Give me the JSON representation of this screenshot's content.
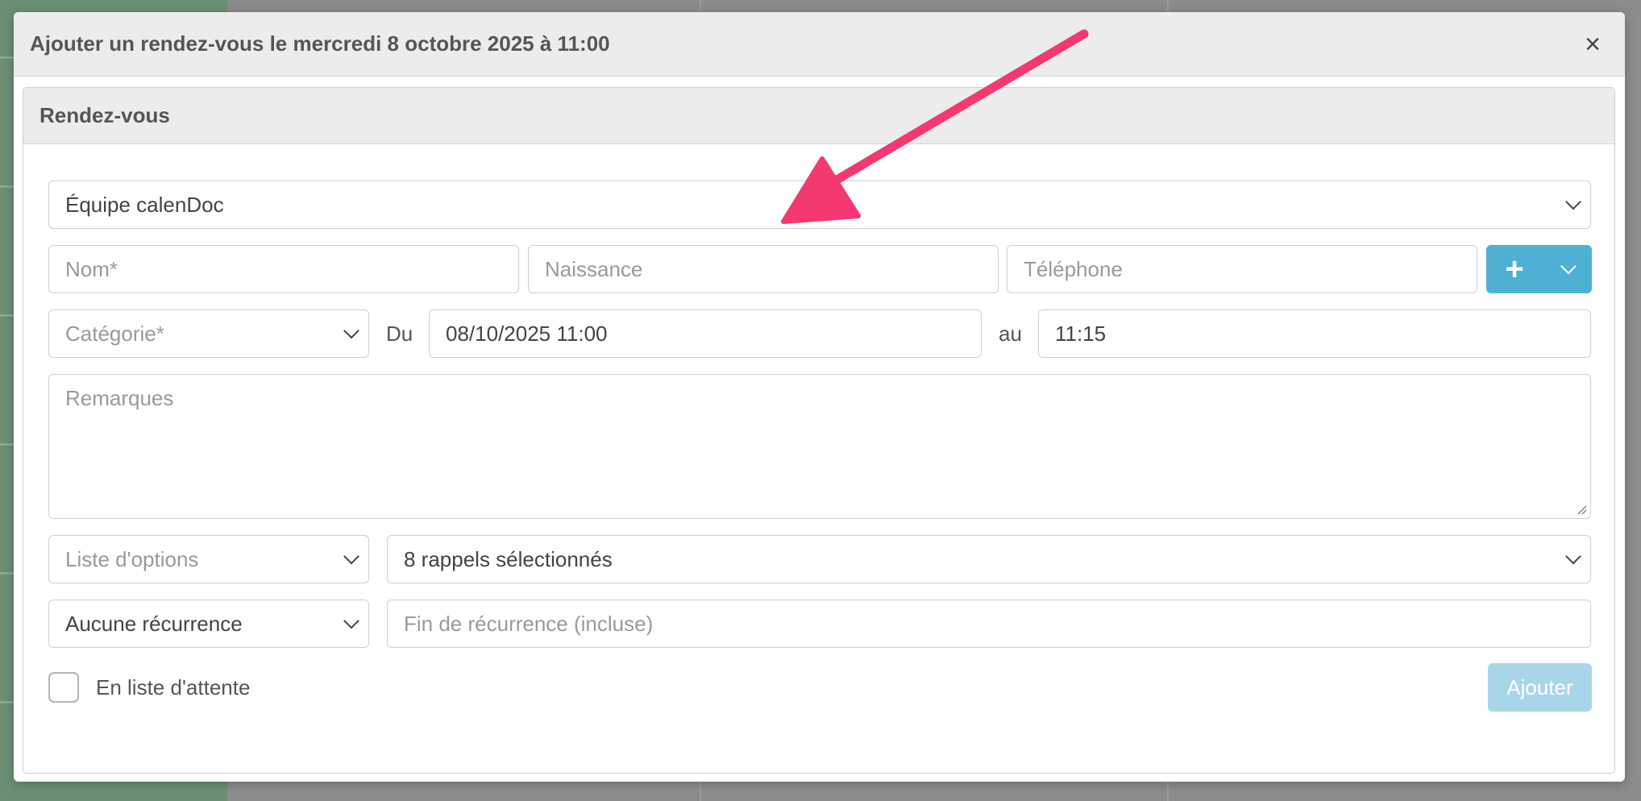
{
  "modal": {
    "title": "Ajouter un rendez-vous le mercredi 8 octobre 2025 à 11:00",
    "close_label": "×"
  },
  "panel": {
    "heading": "Rendez-vous"
  },
  "form": {
    "team_select": "Équipe calenDoc",
    "name_placeholder": "Nom*",
    "birth_placeholder": "Naissance",
    "phone_placeholder": "Téléphone",
    "add_label": "+",
    "category_placeholder": "Catégorie*",
    "from_label": "Du",
    "start_value": "08/10/2025 11:00",
    "to_label": "au",
    "end_value": "11:15",
    "remarks_placeholder": "Remarques",
    "options_placeholder": "Liste d'options",
    "reminders_value": "8 rappels sélectionnés",
    "recurrence_value": "Aucune récurrence",
    "recurrence_end_placeholder": "Fin de récurrence (incluse)",
    "waiting_list_label": "En liste d'attente",
    "submit_label": "Ajouter"
  },
  "colors": {
    "accent": "#4fb0d6",
    "submit_disabled": "#a8d6e8",
    "annotation_arrow": "#f5386f"
  },
  "icons": [
    "close-icon",
    "chevron-down-icon",
    "plus-icon",
    "resize-grip-icon",
    "annotation-arrow"
  ]
}
